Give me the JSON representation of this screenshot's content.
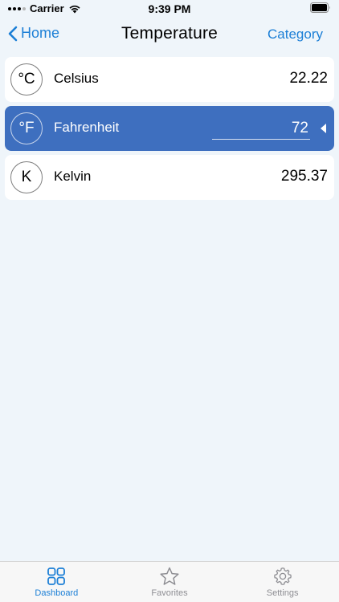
{
  "status_bar": {
    "carrier": "Carrier",
    "time": "9:39 PM"
  },
  "nav": {
    "back_label": "Home",
    "title": "Temperature",
    "right_label": "Category"
  },
  "units": [
    {
      "symbol": "°C",
      "name": "Celsius",
      "value": "22.22",
      "selected": false
    },
    {
      "symbol": "°F",
      "name": "Fahrenheit",
      "value": "72",
      "selected": true
    },
    {
      "symbol": "K",
      "name": "Kelvin",
      "value": "295.37",
      "selected": false
    }
  ],
  "tabs": [
    {
      "label": "Dashboard",
      "icon": "grid-icon",
      "active": true
    },
    {
      "label": "Favorites",
      "icon": "star-icon",
      "active": false
    },
    {
      "label": "Settings",
      "icon": "gear-icon",
      "active": false
    }
  ],
  "colors": {
    "accent": "#1c7fd6",
    "selected_row": "#3e6fbf",
    "background": "#eff5fa"
  }
}
